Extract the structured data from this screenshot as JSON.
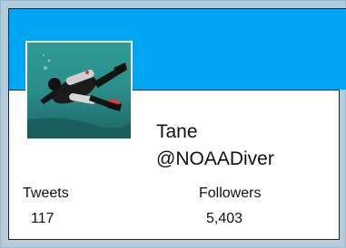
{
  "profile": {
    "name": "Tane",
    "handle": "@NOAADiver",
    "avatar_icon": "diver-photo-icon"
  },
  "stats": {
    "tweets_label": "Tweets",
    "tweets_value": "117",
    "followers_label": "Followers",
    "followers_value": "5,403"
  },
  "colors": {
    "banner": "#00a6f2",
    "background": "#b5ccdc",
    "panel": "#ffffff"
  }
}
